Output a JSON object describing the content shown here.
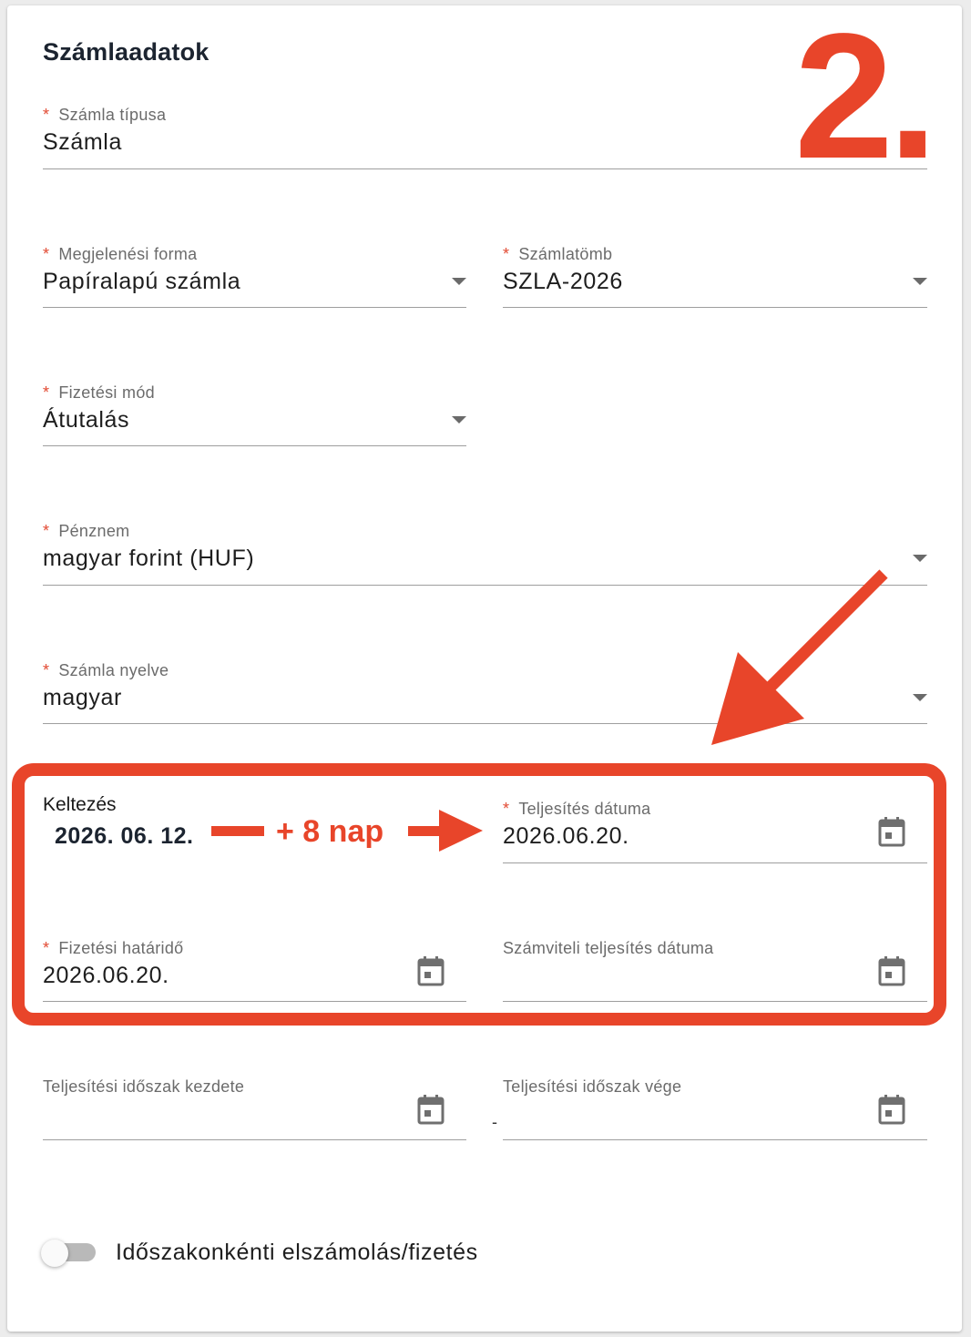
{
  "section_title": "Számlaadatok",
  "step_marker": "2.",
  "required_mark": "*",
  "fields": {
    "invoice_type": {
      "label": "Számla típusa",
      "value": "Számla"
    },
    "display_form": {
      "label": "Megjelenési forma",
      "value": "Papíralapú számla"
    },
    "invoice_block": {
      "label": "Számlatömb",
      "value": "SZLA-2026"
    },
    "payment_method": {
      "label": "Fizetési mód",
      "value": "Átutalás"
    },
    "currency": {
      "label": "Pénznem",
      "value": "magyar forint (HUF)"
    },
    "invoice_language": {
      "label": "Számla nyelve",
      "value": "magyar"
    },
    "issue_date": {
      "label": "Keltezés",
      "value": "2026. 06. 12."
    },
    "fulfillment_date": {
      "label": "Teljesítés dátuma",
      "value": "2026.06.20."
    },
    "payment_deadline": {
      "label": "Fizetési határidő",
      "value": "2026.06.20."
    },
    "accounting_fulfillment_date": {
      "label": "Számviteli teljesítés dátuma",
      "value": ""
    },
    "period_start": {
      "label": "Teljesítési időszak kezdete",
      "value": ""
    },
    "period_end": {
      "label": "Teljesítési időszak vége",
      "value": ""
    }
  },
  "period_separator": "-",
  "annotation": {
    "text": "+ 8 nap",
    "color": "#e8452a"
  },
  "periodic_toggle": {
    "label": "Időszakonkénti elszámolás/fizetés",
    "checked": false
  },
  "icons": {
    "dropdown": "caret-down-icon",
    "calendar": "calendar-icon"
  },
  "colors": {
    "accent": "#e8452a",
    "required": "#e24a33",
    "text": "#1e1e1e",
    "label": "#6b6b6b"
  }
}
